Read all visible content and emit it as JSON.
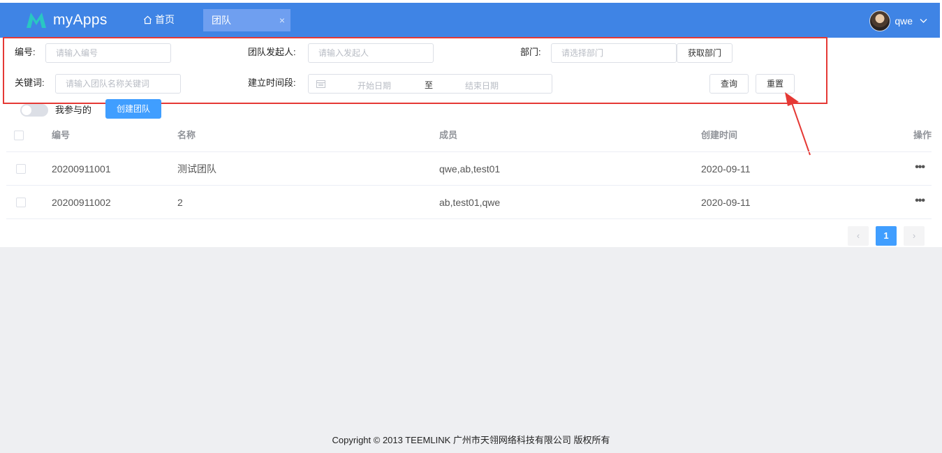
{
  "header": {
    "app_name": "myApps",
    "home_label": "首页",
    "active_tab": "团队",
    "tab_close": "×",
    "user_name": "qwe",
    "brand_color": "#3f84e5"
  },
  "filters": {
    "id_label": "编号:",
    "id_placeholder": "请输入编号",
    "initiator_label": "团队发起人:",
    "initiator_placeholder": "请输入发起人",
    "dept_label": "部门:",
    "dept_placeholder": "请选择部门",
    "get_dept_button": "获取部门",
    "keyword_label": "关键词:",
    "keyword_placeholder": "请输入团队名称关键词",
    "period_label": "建立时间段:",
    "start_date": "开始日期",
    "date_sep": "至",
    "end_date": "结束日期",
    "query_button": "查询",
    "reset_button": "重置"
  },
  "toolbar": {
    "my_participated": "我参与的",
    "create_team_button": "创建团队"
  },
  "table": {
    "headers": [
      "编号",
      "名称",
      "成员",
      "创建时间",
      "操作"
    ],
    "rows": [
      {
        "id": "20200911001",
        "name": "测试团队",
        "members": "qwe,ab,test01",
        "created": "2020-09-11",
        "action": "•••"
      },
      {
        "id": "20200911002",
        "name": "2",
        "members": "ab,test01,qwe",
        "created": "2020-09-11",
        "action": "•••"
      }
    ]
  },
  "pagination": {
    "prev": "‹",
    "current": "1",
    "next": "›"
  },
  "footer": {
    "copyright": "Copyright © 2013 TEEMLINK 广州市天翎网络科技有限公司 版权所有"
  }
}
